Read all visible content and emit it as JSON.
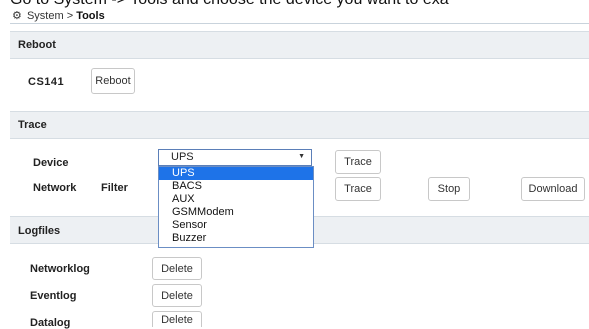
{
  "caption": "Go to System -> Tools and choose the device you want to exa",
  "breadcrumb": {
    "root": "System",
    "separator": ">",
    "current": "Tools"
  },
  "reboot": {
    "title": "Reboot",
    "device_label": "CS141",
    "button": "Reboot"
  },
  "trace": {
    "title": "Trace",
    "device_label": "Device",
    "network_label": "Network",
    "filter_label": "Filter",
    "selected": "UPS",
    "options": [
      "UPS",
      "BACS",
      "AUX",
      "GSMModem",
      "Sensor",
      "Buzzer"
    ],
    "trace_button": "Trace",
    "trace_button_2": "Trace",
    "stop_button": "Stop",
    "download_button": "Download"
  },
  "logfiles": {
    "title": "Logfiles",
    "rows": [
      {
        "label": "Networklog",
        "button": "Delete"
      },
      {
        "label": "Eventlog",
        "button": "Delete"
      },
      {
        "label": "Datalog",
        "button": "Delete"
      }
    ]
  },
  "icons": {
    "breadcrumb_icon": "gear-icon",
    "dropdown_caret": "caret-down-icon"
  },
  "colors": {
    "highlight": "#1e73e8",
    "section_bg": "#edf0f3",
    "focus_border": "#5b7fb8"
  }
}
